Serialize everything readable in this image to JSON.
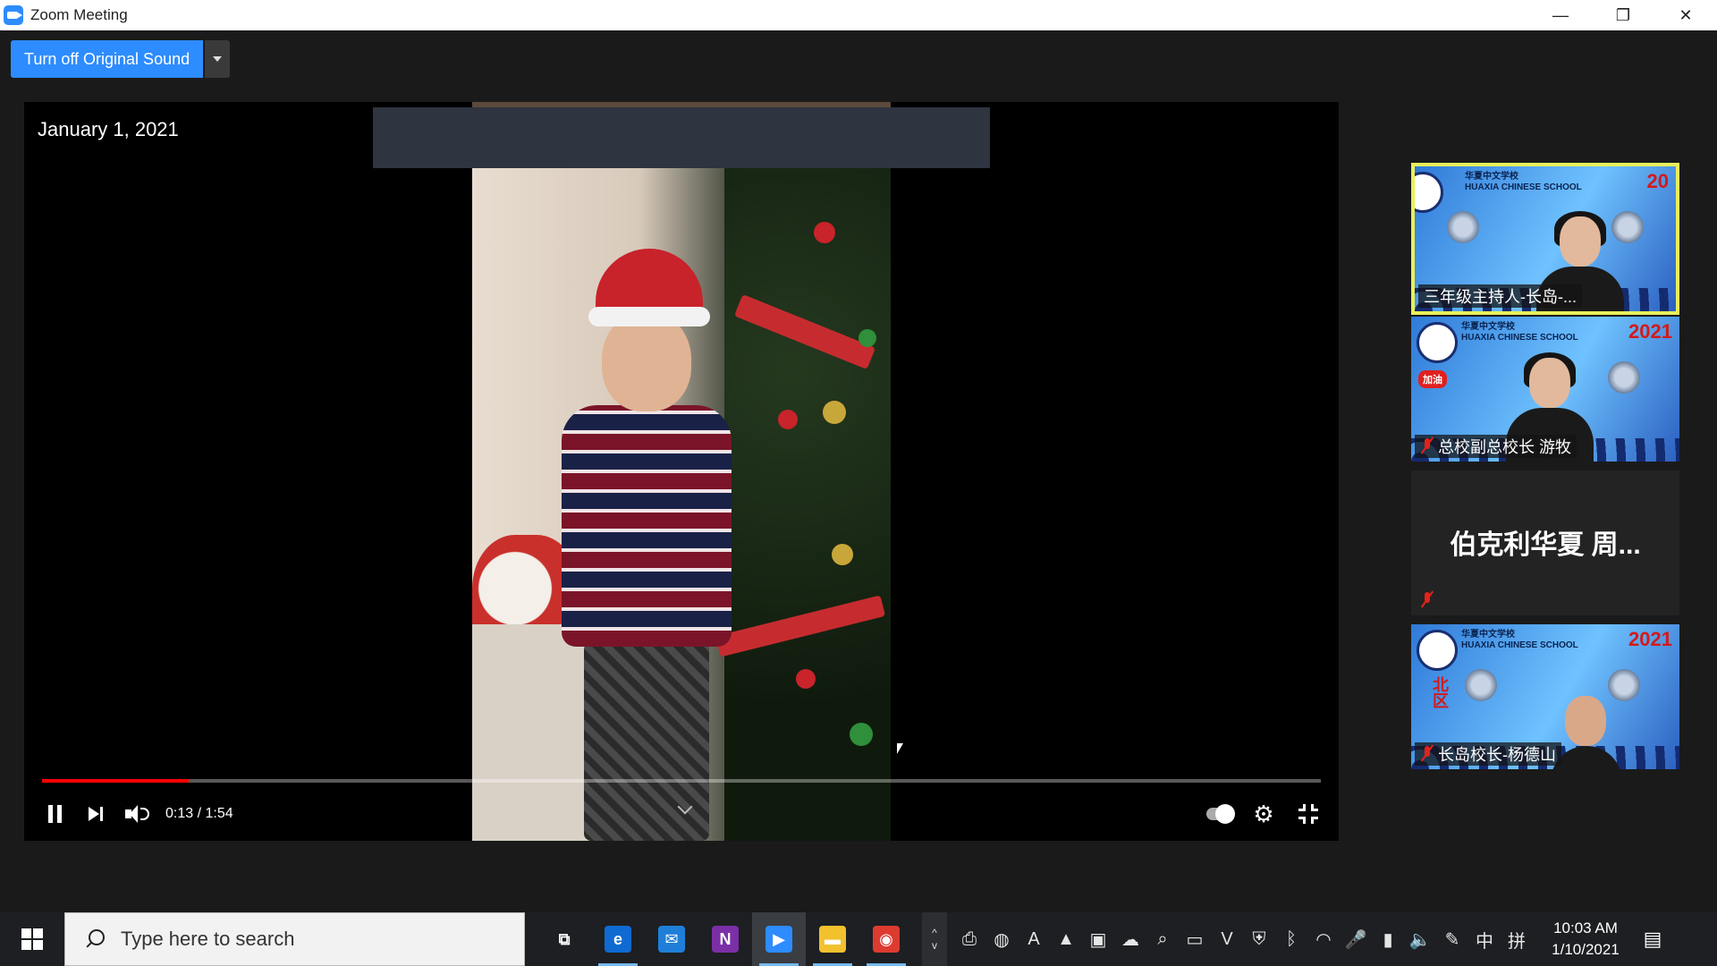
{
  "window": {
    "title": "Zoom Meeting",
    "controls": {
      "minimize": "—",
      "restore": "❐",
      "close": "✕"
    }
  },
  "toolbar": {
    "original_sound_label": "Turn off Original Sound"
  },
  "shared_video": {
    "date_overlay": "January 1, 2021",
    "player": {
      "time_display": "0:13 / 1:54",
      "progress_fraction": 0.115
    }
  },
  "gallery": {
    "tiles": [
      {
        "name": "三年级主持人-长岛-...",
        "school_cn": "华夏中文学校",
        "school_en": "HUAXIA CHINESE SCHOOL",
        "year": "20",
        "active": true,
        "muted": false
      },
      {
        "name": "总校副总校长 游牧",
        "school_cn": "华夏中文学校",
        "school_en": "HUAXIA CHINESE SCHOOL",
        "year": "2021",
        "badge": "加油",
        "active": false,
        "muted": true
      },
      {
        "name": "伯克利华夏 周...",
        "video_off": true,
        "muted": true
      },
      {
        "name": "长岛校长-杨德山",
        "school_cn": "华夏中文学校",
        "school_en": "HUAXIA CHINESE SCHOOL",
        "year": "2021",
        "side_text": "北区",
        "active": false,
        "muted": true
      }
    ]
  },
  "taskbar": {
    "search_placeholder": "Type here to search",
    "apps": [
      {
        "name": "task-view",
        "glyph": "⧉",
        "color": "#00000000"
      },
      {
        "name": "edge",
        "glyph": "e",
        "color": "#0f6ad1"
      },
      {
        "name": "mail",
        "glyph": "✉",
        "color": "#1f7fd8"
      },
      {
        "name": "onenote",
        "glyph": "N",
        "color": "#7b2fa6"
      },
      {
        "name": "zoom",
        "glyph": "▶",
        "color": "#2d8cff"
      },
      {
        "name": "file-explorer",
        "glyph": "▬",
        "color": "#f2c12e"
      },
      {
        "name": "chrome",
        "glyph": "◉",
        "color": "#dd3b30"
      }
    ],
    "tray_up": "^",
    "tray": [
      {
        "name": "printer-icon",
        "glyph": "⎙"
      },
      {
        "name": "globe-icon",
        "glyph": "◍"
      },
      {
        "name": "adobe-icon",
        "glyph": "A"
      },
      {
        "name": "drive-icon",
        "glyph": "▲"
      },
      {
        "name": "zoom-tray-icon",
        "glyph": "▣"
      },
      {
        "name": "onedrive-icon",
        "glyph": "☁"
      },
      {
        "name": "search-tray-icon",
        "glyph": "⌕"
      },
      {
        "name": "display-icon",
        "glyph": "▭"
      },
      {
        "name": "app-v-icon",
        "glyph": "V"
      },
      {
        "name": "defender-icon",
        "glyph": "⛨"
      },
      {
        "name": "bluetooth-icon",
        "glyph": "ᛒ"
      },
      {
        "name": "wifi-icon",
        "glyph": "◠"
      },
      {
        "name": "microphone-icon",
        "glyph": "🎤"
      },
      {
        "name": "battery-icon",
        "glyph": "▮"
      },
      {
        "name": "volume-icon",
        "glyph": "🔈"
      },
      {
        "name": "pen-icon",
        "glyph": "✎"
      },
      {
        "name": "ime-icon",
        "glyph": "中"
      },
      {
        "name": "keyboard-layout-icon",
        "glyph": "拼"
      }
    ],
    "clock": {
      "time": "10:03 AM",
      "date": "1/10/2021"
    },
    "notification_glyph": "▤"
  }
}
